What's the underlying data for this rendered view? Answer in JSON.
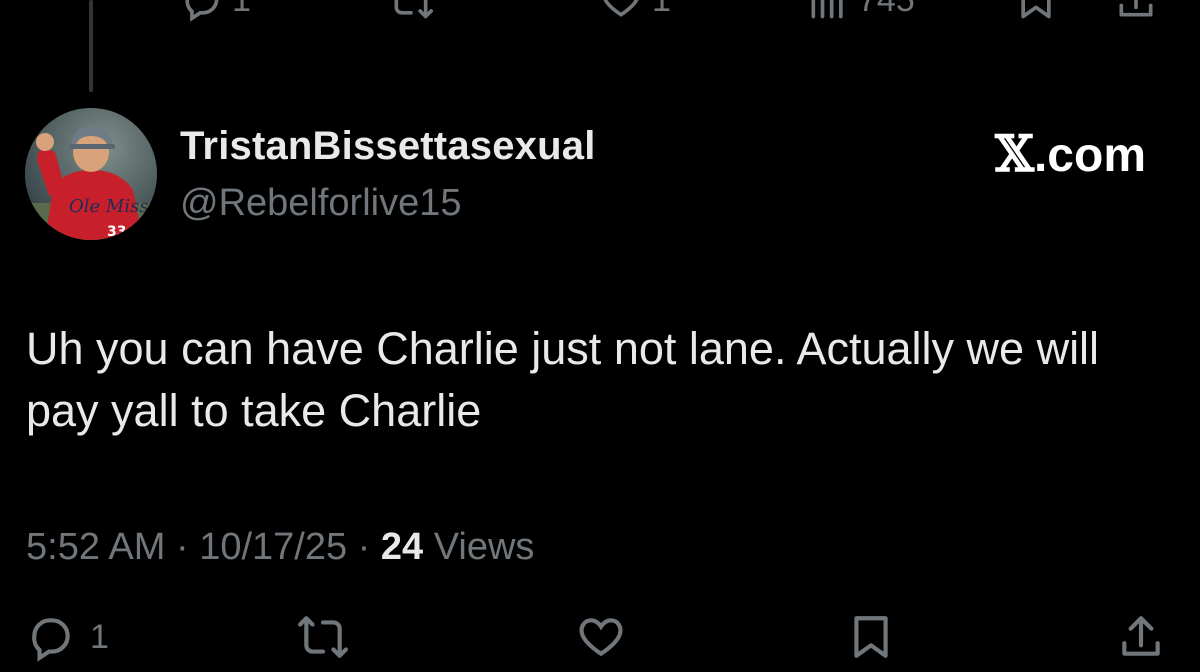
{
  "previous_tweet_actions": {
    "reply_count": "1",
    "like_count": "1",
    "view_count": "745"
  },
  "tweet": {
    "display_name": "TristanBissettasexual",
    "handle": "@Rebelforlive15",
    "brand": {
      "glyph": "𝕏",
      "suffix": ".com"
    },
    "text": "Uh you can have Charlie just not lane. Actually we will pay yall to take Charlie",
    "timestamp": {
      "time": "5:52 AM",
      "separator1": " · ",
      "date": "10/17/25",
      "separator2": " · ",
      "views_count": "24",
      "views_label": " Views"
    }
  },
  "actions": {
    "reply_count": "1"
  },
  "colors": {
    "background": "#000000",
    "primary_text": "#e7e9ea",
    "secondary_text": "#71767b",
    "thread_line": "#333639"
  },
  "icons": [
    "reply-icon",
    "retweet-icon",
    "like-icon",
    "views-icon",
    "bookmark-icon",
    "share-icon"
  ]
}
